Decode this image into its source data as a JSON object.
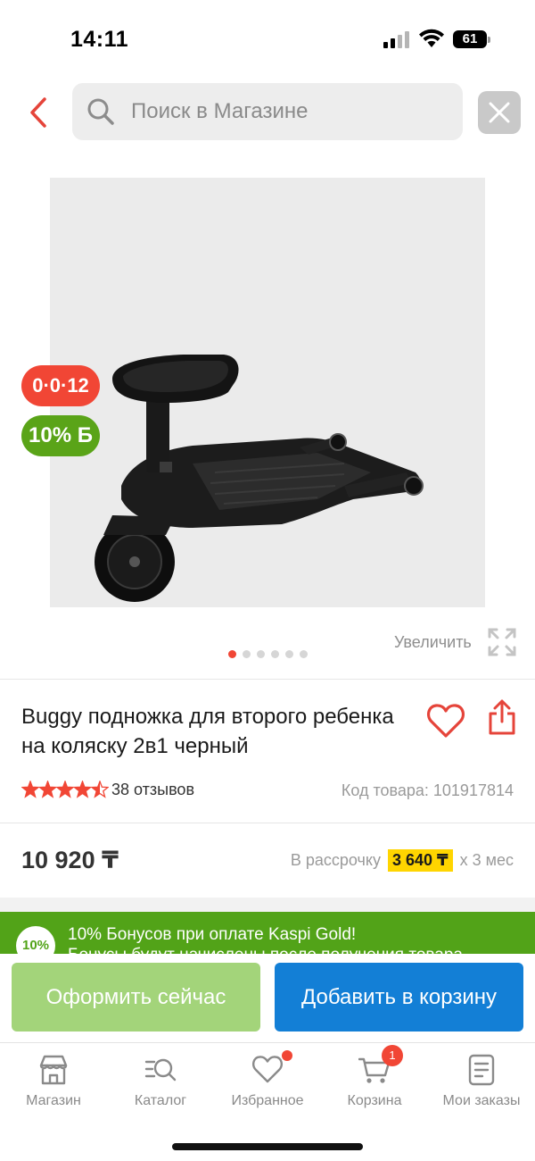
{
  "status_bar": {
    "time": "14:11",
    "battery": "61"
  },
  "search": {
    "placeholder": "Поиск в Магазине"
  },
  "product": {
    "badges": {
      "installment": "0·0·12",
      "bonus": "10% Б"
    },
    "zoom_label": "Увеличить",
    "gallery_pages": 6,
    "gallery_active_index": 0,
    "title": "Buggy подножка для второго ребенка на коляску 2в1 черный",
    "rating": 4.5,
    "reviews": "38 отзывов",
    "sku": "Код товара: 101917814",
    "price": "10 920 ₸",
    "installment": {
      "prefix": "В рассрочку",
      "amount": "3 640 ₸",
      "suffix": "х 3 мес"
    }
  },
  "bonus_banner": {
    "badge": "10%",
    "line1": "10% Бонусов при оплате Kaspi Gold!",
    "line2": "Бонусы будут начислены после получения товара"
  },
  "actions": {
    "buy_now": "Оформить сейчас",
    "add_to_cart": "Добавить в корзину"
  },
  "tabbar": {
    "items": [
      {
        "label": "Магазин",
        "icon": "shop-icon"
      },
      {
        "label": "Каталог",
        "icon": "catalog-search-icon"
      },
      {
        "label": "Избранное",
        "icon": "heart-icon"
      },
      {
        "label": "Корзина",
        "icon": "cart-icon",
        "badge": "1"
      },
      {
        "label": "Мои заказы",
        "icon": "orders-icon"
      }
    ]
  },
  "colors": {
    "accent_red": "#f14635",
    "kaspi_green": "#52a318",
    "cart_blue": "#137fd6",
    "buy_green": "#a3d47a",
    "installment_yellow": "#ffd500"
  }
}
